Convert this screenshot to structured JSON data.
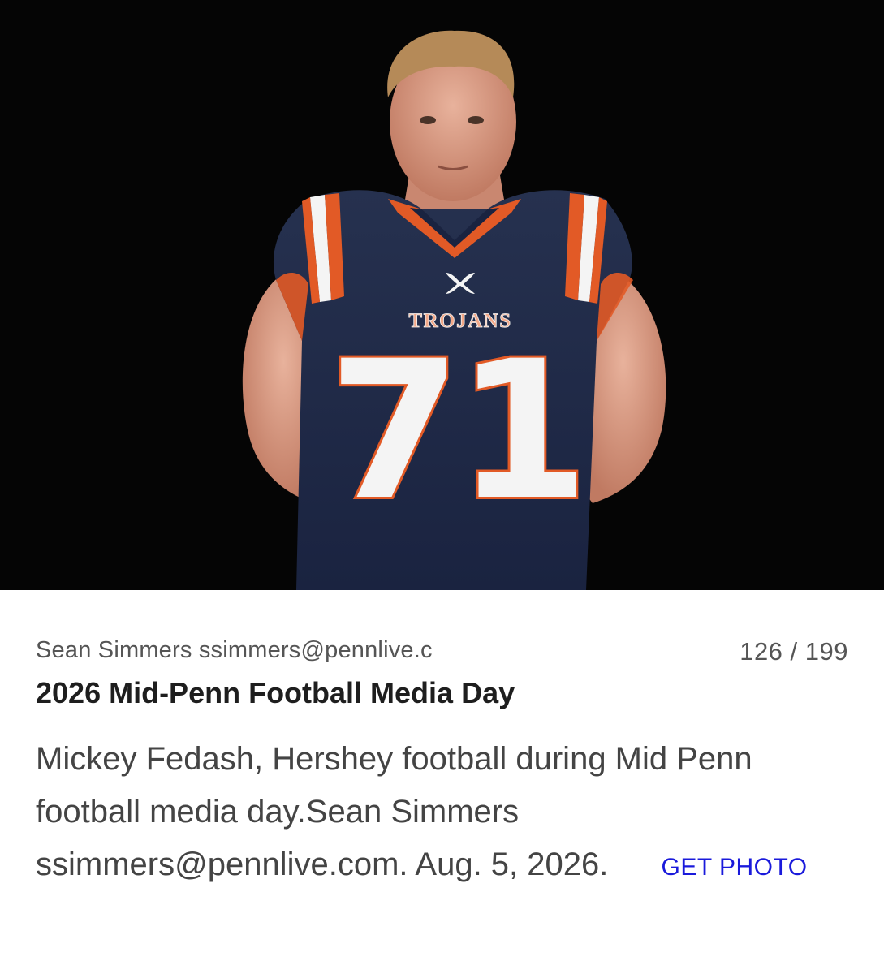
{
  "photo": {
    "jersey_team": "TROJANS",
    "jersey_number": "71",
    "colors": {
      "background": "#050505",
      "jersey_navy": "#1f2a48",
      "jersey_orange": "#e25a26",
      "jersey_white": "#f4f4f4",
      "skin": "#d99a82"
    }
  },
  "caption": {
    "credit": "Sean Simmers ssimmers@pennlive.c",
    "counter": "126 / 199",
    "title": "2026 Mid-Penn Football Media Day",
    "description": "Mickey Fedash, Hershey football during Mid Penn football media day.Sean Simmers ssimmers@pennlive.com. Aug. 5, 2026.",
    "get_photo_label": "GET PHOTO",
    "link_color": "#1a1adb"
  }
}
